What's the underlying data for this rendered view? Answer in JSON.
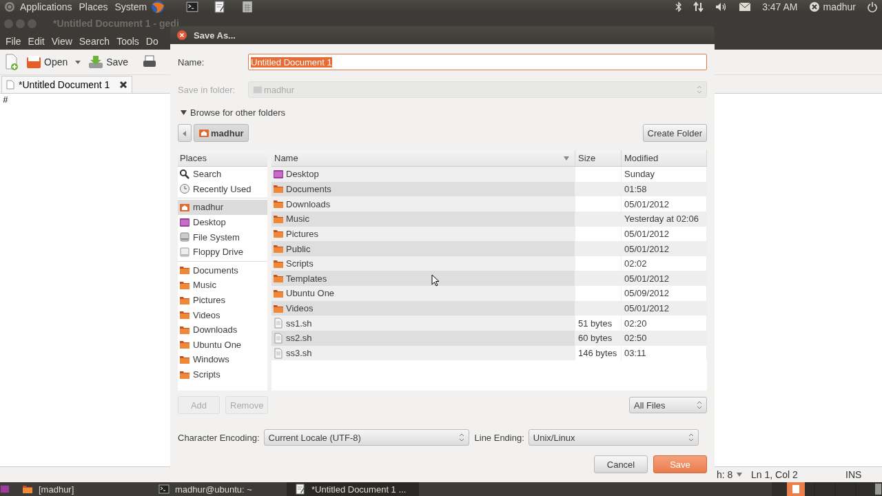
{
  "top_panel": {
    "menus": [
      "Applications",
      "Places",
      "System"
    ],
    "clock": "3:47 AM",
    "user": "madhur"
  },
  "editor_window": {
    "title": "*Untitled Document 1 - gedi",
    "menus": [
      "File",
      "Edit",
      "View",
      "Search",
      "Tools",
      "Do"
    ],
    "toolbar": [
      {
        "label": "Open",
        "kind": "open"
      },
      {
        "label": "Save",
        "kind": "save"
      }
    ],
    "tab": "*Untitled Document 1",
    "text": "#",
    "status": {
      "tab_width": "h: 8",
      "position": "Ln 1, Col 2",
      "mode": "INS"
    }
  },
  "dialog": {
    "title": "Save As...",
    "name_label": "Name:",
    "name_value": "Untitled Document 1",
    "folder_label": "Save in folder:",
    "folder_value": "madhur",
    "folder_disabled": true,
    "browse": {
      "label": "Browse for other folders",
      "expanded": true
    },
    "path": [
      {
        "label": "madhur",
        "selected": true
      }
    ],
    "create_folder": "Create Folder",
    "places": {
      "header": "Places",
      "groups": [
        [
          {
            "label": "Search",
            "kind": "search",
            "selected": false
          },
          {
            "label": "Recently Used",
            "kind": "recent",
            "selected": false
          }
        ],
        [
          {
            "label": "madhur",
            "kind": "home",
            "selected": true
          },
          {
            "label": "Desktop",
            "kind": "desktop",
            "selected": false
          },
          {
            "label": "File System",
            "kind": "drive",
            "selected": false
          },
          {
            "label": "Floppy Drive",
            "kind": "floppy",
            "selected": false
          }
        ],
        [
          {
            "label": "Documents",
            "kind": "folder",
            "selected": false
          },
          {
            "label": "Music",
            "kind": "folder",
            "selected": false
          },
          {
            "label": "Pictures",
            "kind": "folder",
            "selected": false
          },
          {
            "label": "Videos",
            "kind": "folder",
            "selected": false
          },
          {
            "label": "Downloads",
            "kind": "folder",
            "selected": false
          },
          {
            "label": "Ubuntu One",
            "kind": "folder",
            "selected": false
          },
          {
            "label": "Windows",
            "kind": "folder",
            "selected": false
          },
          {
            "label": "Scripts",
            "kind": "folder",
            "selected": false
          }
        ]
      ]
    },
    "files": {
      "columns": [
        {
          "label": "Name",
          "sorted": true
        },
        {
          "label": "Size",
          "sorted": false
        },
        {
          "label": "Modified",
          "sorted": false
        }
      ],
      "rows": [
        {
          "name": "Desktop",
          "kind": "desktop",
          "modified": "Sunday"
        },
        {
          "name": "Documents",
          "kind": "folder",
          "modified": "01:58"
        },
        {
          "name": "Downloads",
          "kind": "folder",
          "modified": "05/01/2012"
        },
        {
          "name": "Music",
          "kind": "folder",
          "modified": "Yesterday at 02:06"
        },
        {
          "name": "Pictures",
          "kind": "folder",
          "modified": "05/01/2012"
        },
        {
          "name": "Public",
          "kind": "folder",
          "modified": "05/01/2012"
        },
        {
          "name": "Scripts",
          "kind": "folder",
          "modified": "02:02"
        },
        {
          "name": "Templates",
          "kind": "folder",
          "modified": "05/01/2012"
        },
        {
          "name": "Ubuntu One",
          "kind": "folder",
          "modified": "05/09/2012"
        },
        {
          "name": "Videos",
          "kind": "folder",
          "modified": "05/01/2012"
        },
        {
          "name": "ss1.sh",
          "kind": "file",
          "size": "51 bytes",
          "modified": "02:20"
        },
        {
          "name": "ss2.sh",
          "kind": "file",
          "size": "60 bytes",
          "modified": "02:50"
        },
        {
          "name": "ss3.sh",
          "kind": "file",
          "size": "146 bytes",
          "modified": "03:11"
        }
      ]
    },
    "add": {
      "label": "Add",
      "disabled": true
    },
    "remove": {
      "label": "Remove",
      "disabled": true
    },
    "filter": "All Files",
    "encoding_label": "Character Encoding:",
    "encoding": "Current Locale (UTF-8)",
    "line_ending_label": "Line Ending:",
    "line_ending": "Unix/Linux",
    "buttons": [
      {
        "label": "Cancel",
        "default": false
      },
      {
        "label": "Save",
        "default": true
      }
    ]
  },
  "taskbar": {
    "items": [
      {
        "label": "[madhur]",
        "kind": "folder",
        "selected": false
      },
      {
        "label": "madhur@ubuntu: ~",
        "kind": "terminal",
        "selected": false
      },
      {
        "label": "*Untitled Document 1 ...",
        "kind": "editor",
        "selected": true
      }
    ]
  }
}
